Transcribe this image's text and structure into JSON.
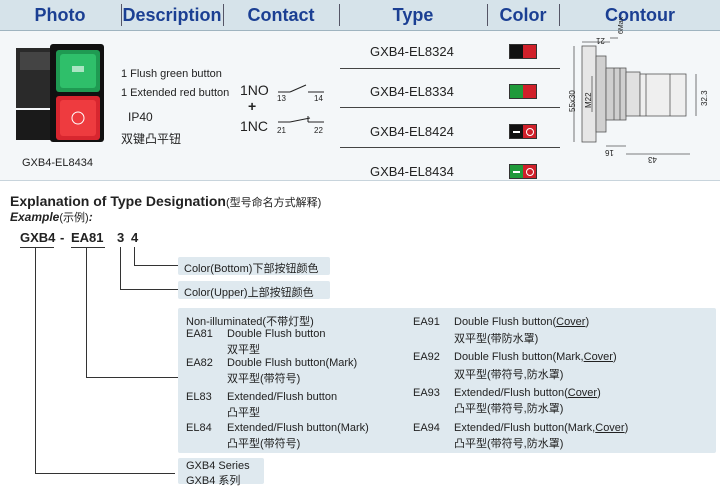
{
  "header": {
    "photo": "Photo",
    "description": "Description",
    "contact": "Contact",
    "type": "Type",
    "color": "Color",
    "contour": "Contour"
  },
  "product": {
    "model_caption": "GXB4-EL8434",
    "desc_lines": [
      "1 Flush green button",
      "1 Extended red button",
      "IP40",
      "双键凸平钮"
    ],
    "contact_no": "1NO",
    "contact_plus": "+",
    "contact_nc": "1NC",
    "term_13": "13",
    "term_14": "14",
    "term_21": "21",
    "term_22": "22"
  },
  "types": [
    {
      "code": "GXB4-EL8324",
      "colors": [
        "#111111",
        "#d0202a"
      ],
      "symbol": false
    },
    {
      "code": "GXB4-EL8334",
      "colors": [
        "#1f9a3a",
        "#d0202a"
      ],
      "symbol": false
    },
    {
      "code": "GXB4-EL8424",
      "colors": [
        "#111111",
        "#d0202a"
      ],
      "symbol": true
    },
    {
      "code": "GXB4-EL8434",
      "colors": [
        "#1f9a3a",
        "#d0202a"
      ],
      "symbol": true
    }
  ],
  "contour": {
    "dim_21": "21",
    "dim_6max": "6Max",
    "dim_55x30": "55x30",
    "dim_m22": "M22",
    "dim_323": "32.3",
    "dim_16": "16",
    "dim_43": "43"
  },
  "explanation": {
    "title": "Explanation of Type Designation",
    "title_cn": "(型号命名方式解释)",
    "example": "Example",
    "example_cn": "(示例)",
    "example_colon": ":",
    "code_gxb4": "GXB4",
    "code_dash": "-",
    "code_ea81": "EA81",
    "code_3": "3",
    "code_4": "4",
    "color_bottom": "Color(Bottom)下部按钮颜色",
    "color_upper": "Color(Upper)上部按钮颜色",
    "non_illuminated": "Non-illuminated(不带灯型)",
    "left_options": [
      {
        "code": "EA81",
        "en": "Double Flush button",
        "cn": "双平型"
      },
      {
        "code": "EA82",
        "en": "Double Flush button(Mark)",
        "cn": "双平型(带符号)"
      },
      {
        "code": "EL83",
        "en": "Extended/Flush button",
        "cn": "凸平型"
      },
      {
        "code": "EL84",
        "en": "Extended/Flush button(Mark)",
        "cn": "凸平型(带符号)"
      }
    ],
    "right_options": [
      {
        "code": "EA91",
        "en_main": "Double Flush button(",
        "en_u": "Cover",
        "en_end": ")",
        "cn": "双平型(带防水罩)"
      },
      {
        "code": "EA92",
        "en_main": "Double Flush button(Mark,",
        "en_u": "Cover",
        "en_end": ")",
        "cn": "双平型(带符号,防水罩)"
      },
      {
        "code": "EA93",
        "en_main": "Extended/Flush button(",
        "en_u": "Cover",
        "en_end": ")",
        "cn": "凸平型(带符号,防水罩)"
      },
      {
        "code": "EA94",
        "en_main": "Extended/Flush button(Mark,",
        "en_u": "Cover",
        "en_end": ")",
        "cn": "凸平型(带符号,防水罩)"
      }
    ],
    "series_en": "GXB4 Series",
    "series_cn": "GXB4 系列"
  }
}
